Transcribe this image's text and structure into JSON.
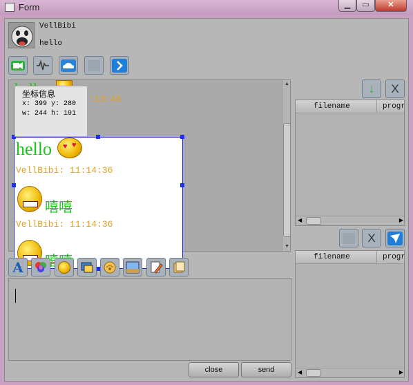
{
  "window": {
    "title": "Form"
  },
  "header": {
    "name": "VellBibi",
    "signature": "hello"
  },
  "toolbar_top": [
    "video-icon",
    "audio-icon",
    "cloud-icon",
    "blank-icon",
    "next-icon"
  ],
  "chat": {
    "top_partial_text": "hello",
    "top_partial_time": ":13:46",
    "messages": [
      {
        "text": "hello",
        "color": "#19c419"
      },
      {
        "meta": "VellBibi:  11:14:36"
      },
      {
        "text": "嘻嘻"
      },
      {
        "meta": "VellBibi:  11:14:36"
      },
      {
        "text": "嘻嘻"
      }
    ]
  },
  "tooltip": {
    "title": "坐标信息",
    "line1": "x: 399 y: 280",
    "line2": "w: 244 h: 191"
  },
  "format_bar": [
    "font-icon",
    "color-icon",
    "emoji-icon",
    "screenshot-icon",
    "shake-icon",
    "image-icon",
    "edit-icon",
    "history-icon"
  ],
  "buttons": {
    "close": "close",
    "send": "send"
  },
  "files_top": {
    "headers": [
      "filename",
      "progre"
    ]
  },
  "files_bottom": {
    "headers": [
      "filename",
      "progre"
    ]
  },
  "colors": {
    "accent_green": "#19c419",
    "accent_orange": "#e0a020",
    "selection_blue": "#1e2bd2"
  }
}
